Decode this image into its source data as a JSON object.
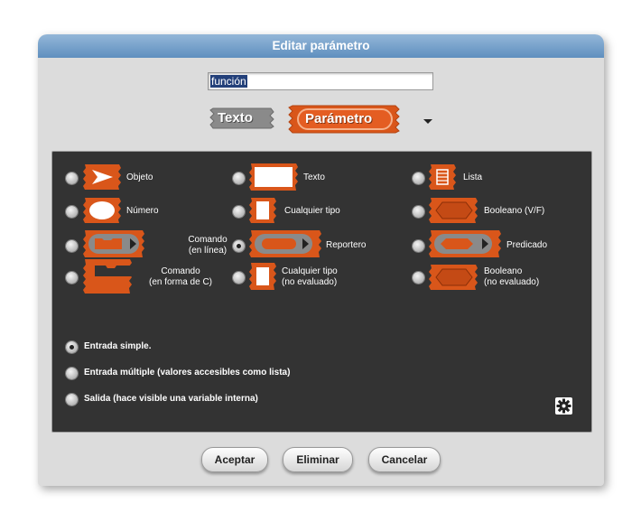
{
  "dialog": {
    "title": "Editar parámetro"
  },
  "name_input": {
    "value": "función"
  },
  "category": {
    "texto_label": "Texto",
    "param_label": "Parámetro"
  },
  "slot_types": [
    {
      "label": "Objeto",
      "selected": false
    },
    {
      "label": "Texto",
      "selected": false
    },
    {
      "label": "Lista",
      "selected": false
    },
    {
      "label": "Número",
      "selected": false
    },
    {
      "label": "Cualquier tipo",
      "selected": false
    },
    {
      "label": "Booleano (V/F)",
      "selected": false
    },
    {
      "label_line1": "Comando",
      "label_line2": "(en línea)",
      "selected": false
    },
    {
      "label": "Reportero",
      "selected": true
    },
    {
      "label": "Predicado",
      "selected": false
    },
    {
      "label_line1": "Comando",
      "label_line2": "(en forma de C)",
      "selected": false
    },
    {
      "label_line1": "Cualquier tipo",
      "label_line2": "(no evaluado)",
      "selected": false
    },
    {
      "label_line1": "Booleano",
      "label_line2": "(no evaluado)",
      "selected": false
    }
  ],
  "input_modes": [
    {
      "label": "Entrada simple.",
      "selected": true
    },
    {
      "label": "Entrada múltiple (valores accesibles como lista)",
      "selected": false
    },
    {
      "label": "Salida (hace visible una variable interna)",
      "selected": false
    }
  ],
  "buttons": {
    "ok": "Aceptar",
    "delete": "Eliminar",
    "cancel": "Cancelar"
  },
  "colors": {
    "accent_orange": "#d9561a",
    "panel": "#333333",
    "title_bar": "#6f9ac6"
  }
}
